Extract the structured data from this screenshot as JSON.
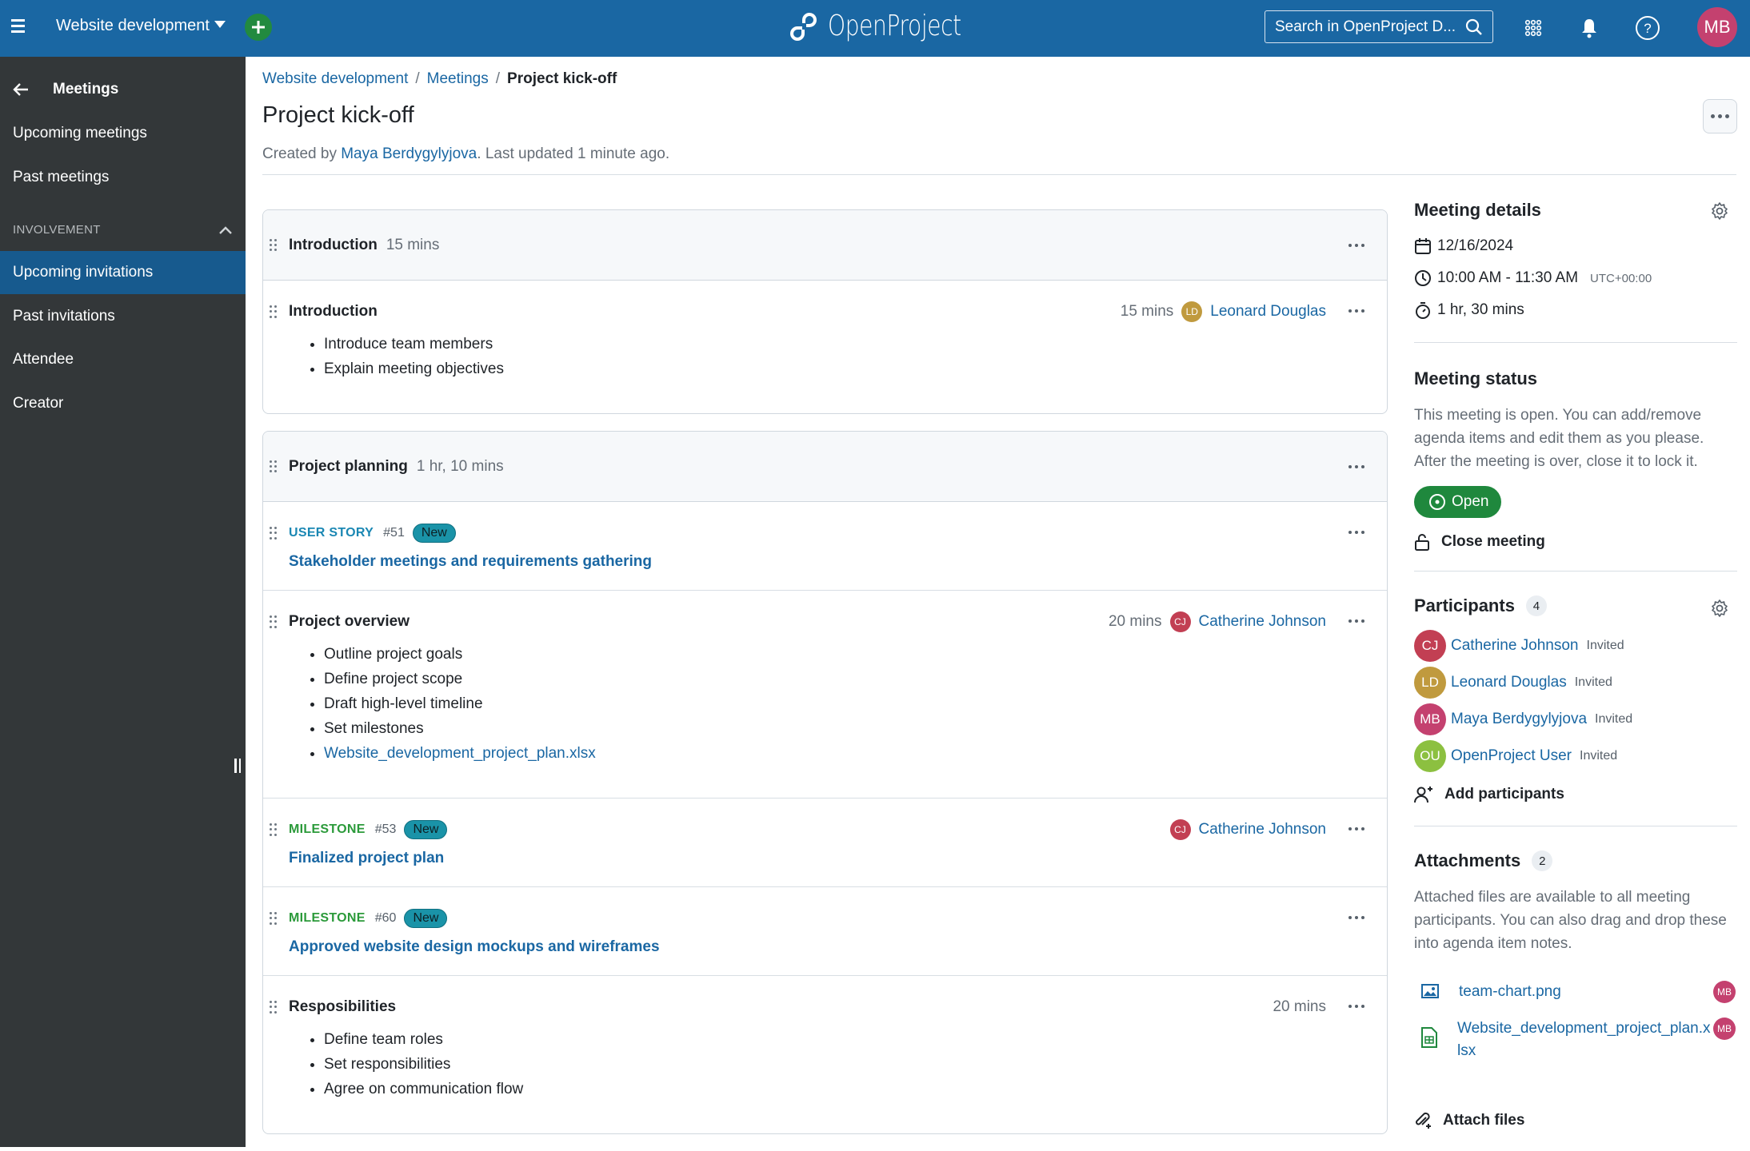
{
  "header": {
    "project_name": "Website development",
    "logo_text": "OpenProject",
    "search_placeholder": "Search in OpenProject D...",
    "user_initials": "MB",
    "brand_color": "#1a67a3",
    "icons": [
      "hamburger-icon",
      "add-icon",
      "search-icon",
      "grid-icon",
      "bell-icon",
      "help-icon"
    ]
  },
  "sidebar": {
    "title": "Meetings",
    "items": [
      {
        "label": "Upcoming meetings",
        "active": false
      },
      {
        "label": "Past meetings",
        "active": false
      }
    ],
    "section_label": "INVOLVEMENT",
    "section_items": [
      {
        "label": "Upcoming invitations",
        "active": true
      },
      {
        "label": "Past invitations",
        "active": false
      },
      {
        "label": "Attendee",
        "active": false
      },
      {
        "label": "Creator",
        "active": false
      }
    ]
  },
  "breadcrumb": {
    "items": [
      "Website development",
      "Meetings"
    ],
    "current": "Project kick-off",
    "separator": "/"
  },
  "page": {
    "title": "Project kick-off",
    "meta_prefix": "Created by",
    "meta_author": "Maya Berdygylyjova",
    "meta_suffix": ". Last updated 1 minute ago."
  },
  "agenda": {
    "sections": [
      {
        "title": "Introduction",
        "duration": "15 mins",
        "items": [
          {
            "kind": "note",
            "title": "Introduction",
            "duration": "15 mins",
            "presenter": {
              "initials": "LD",
              "name": "Leonard Douglas",
              "color": "#c09a3e"
            },
            "notes": [
              "Introduce team members",
              "Explain meeting objectives"
            ]
          }
        ]
      },
      {
        "title": "Project planning",
        "duration": "1 hr, 10 mins",
        "items": [
          {
            "kind": "workpackage",
            "type": "USER STORY",
            "type_color": "#1a87b3",
            "id": "#51",
            "status": "New",
            "subject": "Stakeholder meetings and requirements gathering"
          },
          {
            "kind": "note",
            "title": "Project overview",
            "duration": "20 mins",
            "presenter": {
              "initials": "CJ",
              "name": "Catherine Johnson",
              "color": "#c23f53"
            },
            "notes": [
              "Outline project goals",
              "Define project scope",
              "Draft high-level timeline",
              "Set milestones"
            ],
            "note_link": "Website_development_project_plan.xlsx"
          },
          {
            "kind": "workpackage",
            "type": "MILESTONE",
            "type_color": "#2b9a3a",
            "id": "#53",
            "status": "New",
            "subject": "Finalized project plan",
            "presenter": {
              "initials": "CJ",
              "name": "Catherine Johnson",
              "color": "#c23f53"
            }
          },
          {
            "kind": "workpackage",
            "type": "MILESTONE",
            "type_color": "#2b9a3a",
            "id": "#60",
            "status": "New",
            "subject": "Approved website design mockups and wireframes"
          },
          {
            "kind": "note",
            "title": "Resposibilities",
            "duration": "20 mins",
            "notes": [
              "Define team roles",
              "Set responsibilities",
              "Agree on communication flow"
            ]
          }
        ]
      }
    ]
  },
  "details": {
    "title": "Meeting details",
    "date": "12/16/2024",
    "time": "10:00 AM - 11:30 AM",
    "timezone": "UTC+00:00",
    "duration": "1 hr, 30 mins"
  },
  "status": {
    "title": "Meeting status",
    "description": "This meeting is open. You can add/remove agenda items and edit them as you please. After the meeting is over, close it to lock it.",
    "badge": "Open",
    "close_label": "Close meeting"
  },
  "participants": {
    "title": "Participants",
    "count": "4",
    "list": [
      {
        "initials": "CJ",
        "name": "Catherine Johnson",
        "status": "Invited",
        "color": "#c23f53"
      },
      {
        "initials": "LD",
        "name": "Leonard Douglas",
        "status": "Invited",
        "color": "#c09a3e"
      },
      {
        "initials": "MB",
        "name": "Maya Berdygylyjova",
        "status": "Invited",
        "color": "#c4416f"
      },
      {
        "initials": "OU",
        "name": "OpenProject User",
        "status": "Invited",
        "color": "#8cc040"
      }
    ],
    "add_label": "Add participants"
  },
  "attachments": {
    "title": "Attachments",
    "count": "2",
    "description": "Attached files are available to all meeting participants. You can also drag and drop these into agenda item notes.",
    "files": [
      {
        "name": "team-chart.png",
        "icon": "image-file-icon",
        "uploader": "MB"
      },
      {
        "name": "Website_development_project_plan.xlsx",
        "icon": "spreadsheet-file-icon",
        "uploader": "MB"
      }
    ],
    "attach_label": "Attach files"
  }
}
